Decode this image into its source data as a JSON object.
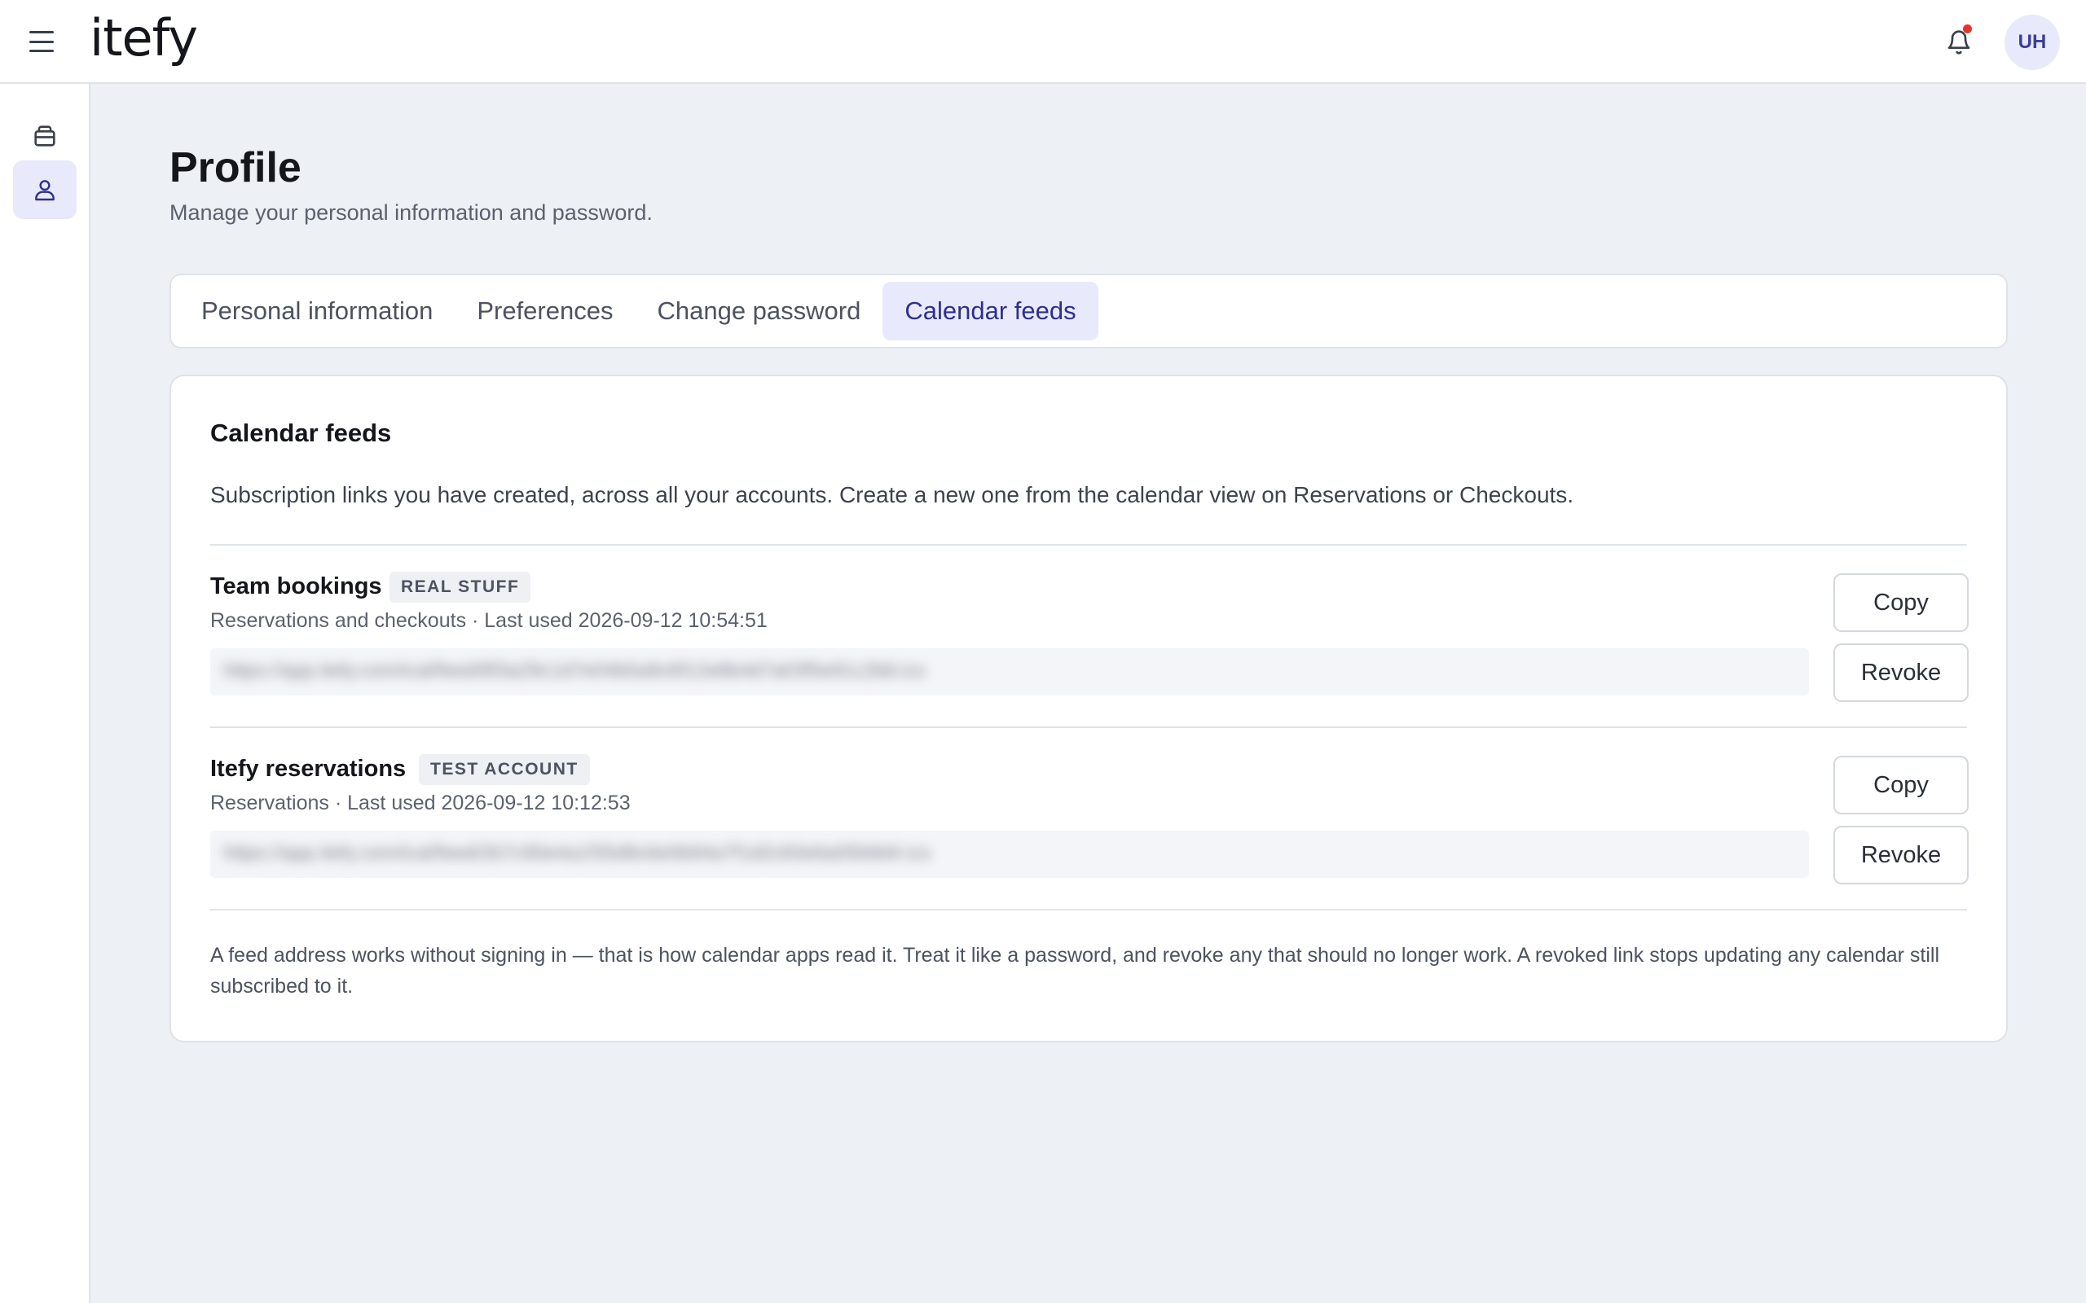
{
  "app": {
    "logo": "itefy",
    "avatar_initials": "UH"
  },
  "sidebar": {
    "items": [
      {
        "icon": "inventory-icon"
      },
      {
        "icon": "user-icon",
        "active": true
      }
    ]
  },
  "page": {
    "title": "Profile",
    "subtitle": "Manage your personal information and password."
  },
  "tabs": [
    {
      "label": "Personal information"
    },
    {
      "label": "Preferences"
    },
    {
      "label": "Change password"
    },
    {
      "label": "Calendar feeds",
      "active": true
    }
  ],
  "card": {
    "title": "Calendar feeds",
    "description": "Subscription links you have created, across all your accounts. Create a new one from the calendar view on Reservations or Checkouts.",
    "feeds": [
      {
        "name": "Team bookings",
        "badge": "REAL STUFF",
        "meta": "Reservations and checkouts · Last used 2026-09-12 10:54:51",
        "copy_label": "Copy",
        "revoke_label": "Revoke"
      },
      {
        "name": "Itefy reservations",
        "badge": "TEST ACCOUNT",
        "meta": "Reservations · Last used 2026-09-12 10:12:53",
        "copy_label": "Copy",
        "revoke_label": "Revoke"
      }
    ],
    "footnote": "A feed address works without signing in — that is how calendar apps read it. Treat it like a password, and revoke any that should no longer work. A revoked link stops updating any calendar still subscribed to it."
  },
  "colors": {
    "accent": "#2e2f8f",
    "accent_bg": "#e8eafb",
    "notification_dot": "#e2342b",
    "page_bg": "#edf0f4"
  }
}
